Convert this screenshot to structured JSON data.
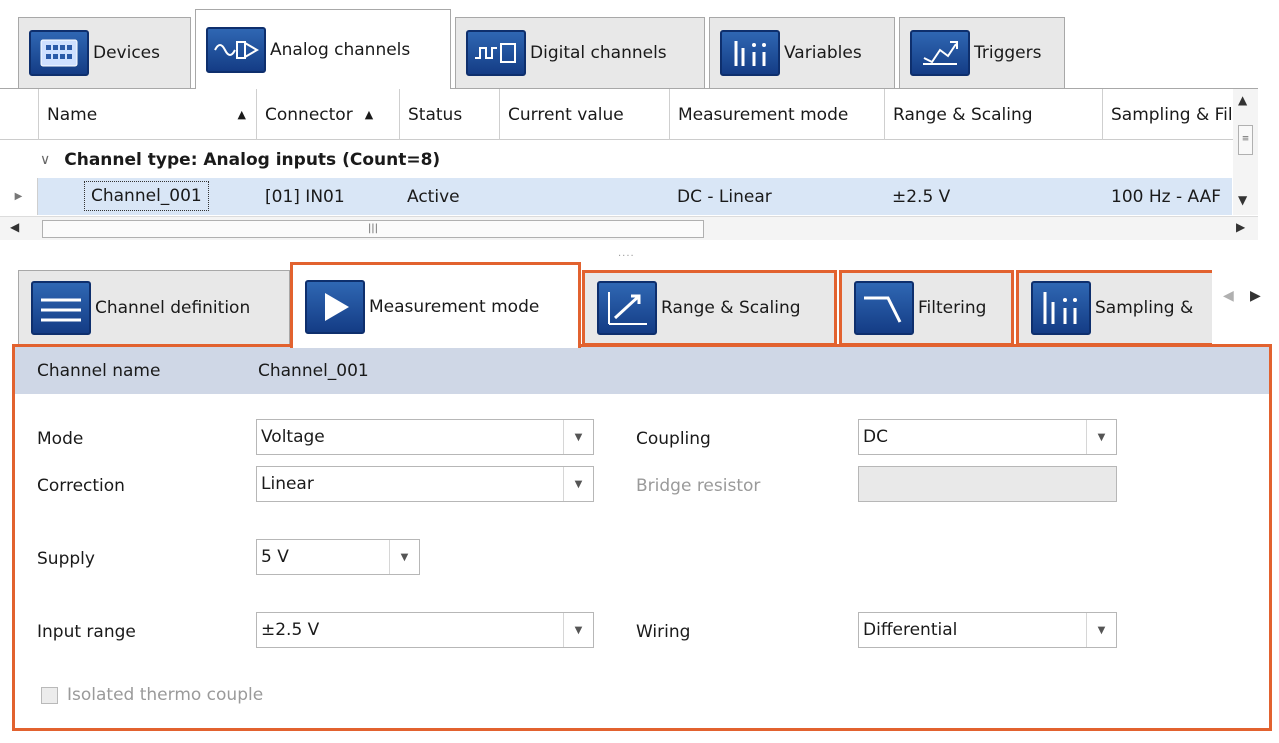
{
  "top_tabs": [
    {
      "label": "Devices",
      "icon": "devices-icon"
    },
    {
      "label": "Analog channels",
      "icon": "analog-channel-icon"
    },
    {
      "label": "Digital channels",
      "icon": "digital-channel-icon"
    },
    {
      "label": "Variables",
      "icon": "variables-icon"
    },
    {
      "label": "Triggers",
      "icon": "triggers-icon"
    }
  ],
  "active_top_tab": "Analog channels",
  "grid": {
    "columns": [
      {
        "label": "Name",
        "sort": "▲"
      },
      {
        "label": "Connector",
        "sort": "▲"
      },
      {
        "label": "Status",
        "sort": ""
      },
      {
        "label": "Current value",
        "sort": ""
      },
      {
        "label": "Measurement mode",
        "sort": ""
      },
      {
        "label": "Range & Scaling",
        "sort": ""
      },
      {
        "label": "Sampling & Filt",
        "sort": ""
      }
    ],
    "group_label": "Channel type: Analog inputs (Count=8)",
    "row": {
      "name": "Channel_001",
      "connector": "[01] IN01",
      "status": "Active",
      "current_value": "",
      "measurement_mode": "DC - Linear",
      "range_scaling": "±2.5 V",
      "sampling": "100 Hz - AAF"
    }
  },
  "lower_tabs": [
    {
      "label": "Channel definition",
      "icon": "channel-definition-icon"
    },
    {
      "label": "Measurement mode",
      "icon": "play-icon"
    },
    {
      "label": "Range & Scaling",
      "icon": "range-scaling-icon"
    },
    {
      "label": "Filtering",
      "icon": "filter-icon"
    },
    {
      "label": "Sampling &",
      "icon": "sampling-icon"
    }
  ],
  "active_lower_tab": "Measurement mode",
  "panel": {
    "channel_name_label": "Channel name",
    "channel_name_value": "Channel_001",
    "mode_label": "Mode",
    "mode_value": "Voltage",
    "coupling_label": "Coupling",
    "coupling_value": "DC",
    "correction_label": "Correction",
    "correction_value": "Linear",
    "bridge_resistor_label": "Bridge resistor",
    "bridge_resistor_value": "",
    "supply_label": "Supply",
    "supply_value": "5 V",
    "input_range_label": "Input range",
    "input_range_value": "±2.5 V",
    "wiring_label": "Wiring",
    "wiring_value": "Differential",
    "isolated_label": "Isolated thermo couple",
    "isolated_checked": false
  },
  "colors": {
    "highlight_border": "#e2622f",
    "icon_blue": "#1f4f9e",
    "row_selected": "#d9e6f6",
    "panel_header": "#cfd7e6"
  }
}
